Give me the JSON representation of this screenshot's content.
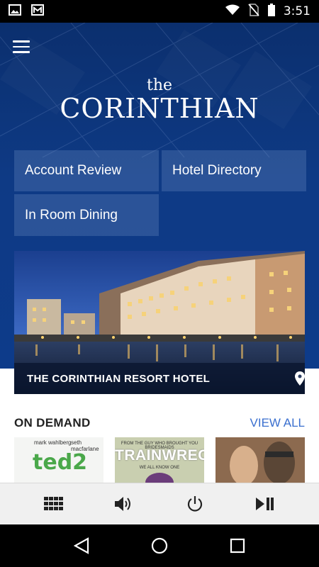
{
  "status_bar": {
    "time": "3:51",
    "icons": [
      "image-icon",
      "gmail-icon",
      "wifi-icon",
      "no-sim-icon",
      "battery-icon"
    ]
  },
  "header": {
    "logo_the": "the",
    "logo_name": "CORINTHIAN"
  },
  "tiles": [
    {
      "label": "Account Review"
    },
    {
      "label": "Hotel Directory"
    },
    {
      "label": "In Room Dining"
    }
  ],
  "hotel_card": {
    "caption": "THE CORINTHIAN RESORT HOTEL"
  },
  "on_demand": {
    "title": "ON DEMAND",
    "view_all": "VIEW ALL",
    "posters": [
      {
        "actor1": "mark wahlberg",
        "actor2": "seth macfarlane",
        "title": "ted2"
      },
      {
        "tagline": "FROM THE GUY WHO BROUGHT YOU BRIDESMAIDS",
        "title": "TRAINWRECK",
        "subtitle": "WE ALL KNOW ONE"
      },
      {
        "title": ""
      }
    ]
  },
  "bottom_bar": {
    "buttons": [
      "grid-icon",
      "volume-icon",
      "power-icon",
      "play-pause-icon"
    ]
  },
  "nav_bar": {
    "buttons": [
      "back-icon",
      "home-icon",
      "recents-icon"
    ]
  },
  "colors": {
    "hero": "#0d3b8a",
    "accent": "#3a6fcf",
    "tile": "#5d7fb5"
  }
}
